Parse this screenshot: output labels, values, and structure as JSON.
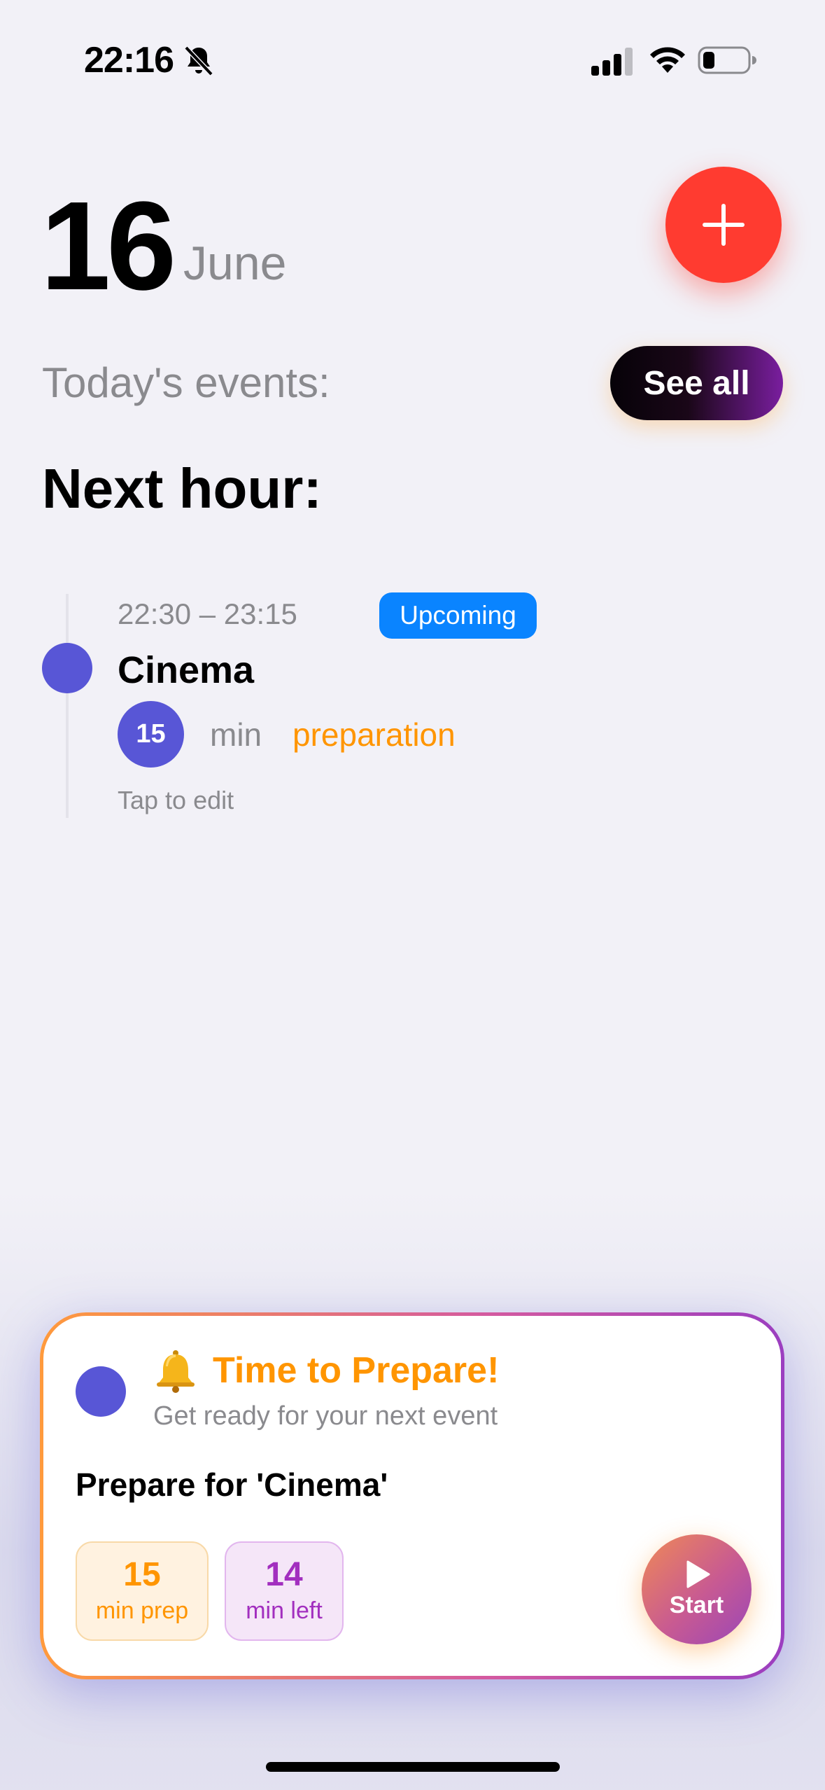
{
  "status_bar": {
    "time": "22:16",
    "icons": [
      "bell-slash-icon",
      "cellular-signal-icon",
      "wifi-icon",
      "battery-icon"
    ]
  },
  "header": {
    "day": "16",
    "month": "June",
    "add_icon": "plus-icon"
  },
  "todays_events": {
    "label": "Today's events:",
    "see_all_label": "See all"
  },
  "next_hour": {
    "heading": "Next hour:"
  },
  "event": {
    "time_range": "22:30 – 23:15",
    "status": "Upcoming",
    "title": "Cinema",
    "prep_minutes": "15",
    "prep_unit": "min",
    "prep_word": "preparation",
    "hint": "Tap to edit"
  },
  "prepare_card": {
    "title": "Time to Prepare!",
    "subtitle": "Get ready for your next event",
    "prepare_text": "Prepare for 'Cinema'",
    "prep_value": "15",
    "prep_label": "min prep",
    "left_value": "14",
    "left_label": "min left",
    "start_label": "Start"
  },
  "colors": {
    "accent_red": "#ff3b30",
    "event_indigo": "#5856d6",
    "badge_blue": "#0a84ff",
    "prep_orange": "#ff9500",
    "purple": "#a22fbf",
    "background": "#f2f1f7"
  }
}
